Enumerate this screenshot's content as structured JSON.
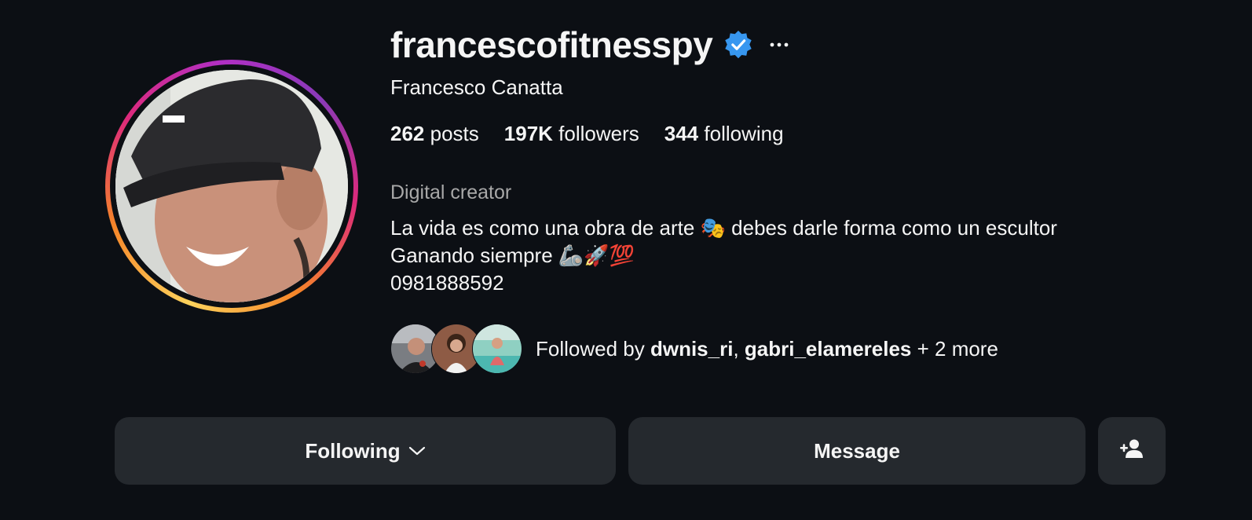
{
  "profile": {
    "username": "francescofitnesspy",
    "full_name": "Francesco Canatta",
    "verified": true,
    "stats": {
      "posts_count": "262",
      "posts_label": "posts",
      "followers_count": "197K",
      "followers_label": "followers",
      "following_count": "344",
      "following_label": "following"
    },
    "category": "Digital creator",
    "bio": {
      "line1": "La vida es como una obra de arte 🎭 debes darle forma como un escultor",
      "line2": "Ganando siempre 🦾🚀💯",
      "line3": "0981888592"
    },
    "followed_by": {
      "prefix": "Followed by ",
      "user1": "dwnis_ri",
      "separator": ", ",
      "user2": "gabri_elamereles",
      "suffix": " + 2 more"
    }
  },
  "actions": {
    "following_label": "Following",
    "message_label": "Message"
  },
  "icons": {
    "verified": "verified-badge-icon",
    "more": "more-options-icon",
    "following_dropdown": "chevron-down-icon",
    "suggest": "add-person-icon"
  },
  "colors": {
    "background": "#0c0f14",
    "button": "#25292e",
    "verified_blue": "#3797f0",
    "muted_text": "#a8a8a8"
  }
}
